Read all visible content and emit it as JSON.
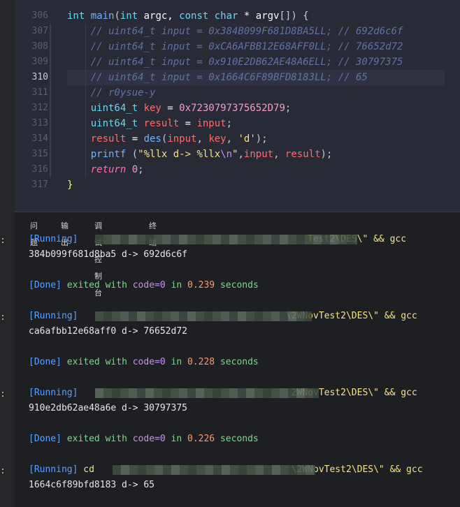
{
  "editor": {
    "lines": [
      {
        "num": "306",
        "tokens": [
          {
            "t": "int ",
            "c": "kw"
          },
          {
            "t": "main",
            "c": "fn"
          },
          {
            "t": "(",
            "c": "pun"
          },
          {
            "t": "int ",
            "c": "kw"
          },
          {
            "t": "argc, ",
            "c": "ty"
          },
          {
            "t": "const ",
            "c": "kw"
          },
          {
            "t": "char ",
            "c": "kw"
          },
          {
            "t": "* ",
            "c": "op"
          },
          {
            "t": "argv",
            "c": "ty"
          },
          {
            "t": "[]) {",
            "c": "pun"
          }
        ]
      },
      {
        "num": "307",
        "tokens": [
          {
            "t": "    // uint64_t input = 0x384B099F681D8BA5LL; // 692d6c6f",
            "c": "cm"
          }
        ]
      },
      {
        "num": "308",
        "tokens": [
          {
            "t": "    // uint64_t input = 0xCA6AFBB12E68AFF0LL; // 76652d72",
            "c": "cm"
          }
        ]
      },
      {
        "num": "309",
        "tokens": [
          {
            "t": "    // uint64_t input = 0x910E2DB62AE48A6ELL; // 30797375",
            "c": "cm"
          }
        ]
      },
      {
        "num": "310",
        "tokens": [
          {
            "t": "    // uint64_t input = 0x1664C6F89BFD8183LL; // 65",
            "c": "cm"
          }
        ]
      },
      {
        "num": "311",
        "tokens": [
          {
            "t": "    // r0ysue-y",
            "c": "cm"
          }
        ]
      },
      {
        "num": "312",
        "tokens": [
          {
            "t": "    uint64_t ",
            "c": "kw"
          },
          {
            "t": "key ",
            "c": "var"
          },
          {
            "t": "= ",
            "c": "op"
          },
          {
            "t": "0x7230797375652D79",
            "c": "num"
          },
          {
            "t": ";",
            "c": "pun"
          }
        ]
      },
      {
        "num": "313",
        "tokens": [
          {
            "t": "    uint64_t ",
            "c": "kw"
          },
          {
            "t": "result ",
            "c": "var"
          },
          {
            "t": "= ",
            "c": "op"
          },
          {
            "t": "input",
            "c": "var"
          },
          {
            "t": ";",
            "c": "pun"
          }
        ]
      },
      {
        "num": "314",
        "tokens": [
          {
            "t": "    result ",
            "c": "var"
          },
          {
            "t": "= ",
            "c": "op"
          },
          {
            "t": "des",
            "c": "fn"
          },
          {
            "t": "(",
            "c": "pun"
          },
          {
            "t": "input",
            "c": "var"
          },
          {
            "t": ", ",
            "c": "pun"
          },
          {
            "t": "key",
            "c": "var"
          },
          {
            "t": ", ",
            "c": "pun"
          },
          {
            "t": "'d'",
            "c": "str"
          },
          {
            "t": ");",
            "c": "pun"
          }
        ]
      },
      {
        "num": "315",
        "tokens": [
          {
            "t": "    printf ",
            "c": "fn"
          },
          {
            "t": "(",
            "c": "pun"
          },
          {
            "t": "\"%llx d-> %llx",
            "c": "str"
          },
          {
            "t": "\\n",
            "c": "esc"
          },
          {
            "t": "\"",
            "c": "str"
          },
          {
            "t": ",",
            "c": "pun"
          },
          {
            "t": "input",
            "c": "var"
          },
          {
            "t": ", ",
            "c": "pun"
          },
          {
            "t": "result",
            "c": "var"
          },
          {
            "t": ");",
            "c": "pun"
          }
        ]
      },
      {
        "num": "316",
        "tokens": [
          {
            "t": "    return ",
            "c": "ctl"
          },
          {
            "t": "0",
            "c": "num"
          },
          {
            "t": ";",
            "c": "pun"
          }
        ]
      },
      {
        "num": "317",
        "tokens": [
          {
            "t": "}",
            "c": "brk"
          }
        ]
      }
    ]
  },
  "panel": {
    "tabs": [
      "问题",
      "输出",
      "调试控制台",
      "终端"
    ],
    "output": [
      {
        "tokens": [
          {
            "t": "[Running] ",
            "c": "o-run"
          },
          {
            "t": "                                         Test2\\DES\\\" && gcc",
            "c": "o-path"
          }
        ],
        "pixelate": [
          95,
          470
        ]
      },
      {
        "tokens": [
          {
            "t": "384b099f681d8ba5 d-> 692d6c6f",
            "c": ""
          }
        ]
      },
      {
        "tokens": []
      },
      {
        "tokens": [
          {
            "t": "[Done] ",
            "c": "o-done"
          },
          {
            "t": "exited with ",
            "c": "o-green"
          },
          {
            "t": "code=0 ",
            "c": "o-purple"
          },
          {
            "t": "in ",
            "c": "o-green"
          },
          {
            "t": "0.239 ",
            "c": "o-num"
          },
          {
            "t": "seconds",
            "c": "o-green"
          }
        ]
      },
      {
        "tokens": []
      },
      {
        "tokens": [
          {
            "t": "[Running] ",
            "c": "o-run"
          },
          {
            "t": "                                     \\2WNovTest2\\DES\\\" && gcc",
            "c": "o-path"
          }
        ],
        "pixelate": [
          95,
          405
        ]
      },
      {
        "tokens": [
          {
            "t": "ca6afbb12e68aff0 d-> 76652d72",
            "c": ""
          }
        ]
      },
      {
        "tokens": []
      },
      {
        "tokens": [
          {
            "t": "[Done] ",
            "c": "o-done"
          },
          {
            "t": "exited with ",
            "c": "o-green"
          },
          {
            "t": "code=0 ",
            "c": "o-purple"
          },
          {
            "t": "in ",
            "c": "o-green"
          },
          {
            "t": "0.228 ",
            "c": "o-num"
          },
          {
            "t": "seconds",
            "c": "o-green"
          }
        ]
      },
      {
        "tokens": []
      },
      {
        "tokens": [
          {
            "t": "[Running] ",
            "c": "o-run"
          },
          {
            "t": "                                      2WNovTest2\\DES\\\" && gcc",
            "c": "o-path"
          }
        ],
        "pixelate": [
          95,
          415
        ]
      },
      {
        "tokens": [
          {
            "t": "910e2db62ae48a6e d-> 30797375",
            "c": ""
          }
        ]
      },
      {
        "tokens": []
      },
      {
        "tokens": [
          {
            "t": "[Done] ",
            "c": "o-done"
          },
          {
            "t": "exited with ",
            "c": "o-green"
          },
          {
            "t": "code=0 ",
            "c": "o-purple"
          },
          {
            "t": "in ",
            "c": "o-green"
          },
          {
            "t": "0.226 ",
            "c": "o-num"
          },
          {
            "t": "seconds",
            "c": "o-green"
          }
        ]
      },
      {
        "tokens": []
      },
      {
        "tokens": [
          {
            "t": "[Running] ",
            "c": "o-run"
          },
          {
            "t": "cd                                    \\2WNovTest2\\DES\\\" && gcc",
            "c": "o-path"
          }
        ],
        "pixelate": [
          120,
          410
        ]
      },
      {
        "tokens": [
          {
            "t": "1664c6f89bfd8183 d-> 65",
            "c": ""
          }
        ]
      }
    ]
  }
}
